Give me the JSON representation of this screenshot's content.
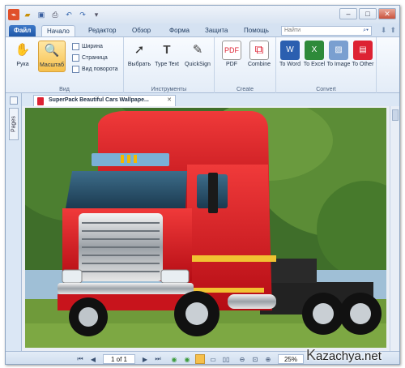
{
  "tabs": {
    "file": "Файл",
    "home": "Начало",
    "editor": "Редактор",
    "review": "Обзор",
    "form": "Форма",
    "protect": "Защита",
    "help": "Помощь"
  },
  "search": {
    "placeholder": "Найти"
  },
  "ribbon": {
    "hand": "Рука",
    "zoom": "Масштаб",
    "width": "Ширина",
    "page": "Страница",
    "rotate_view": "Вид поворота",
    "group_view": "Вид",
    "select": "Выбрать",
    "type_text": "Type Text",
    "quicksign": "QuickSign",
    "group_tools": "Инструменты",
    "pdf": "PDF",
    "combine": "Combine",
    "group_create": "Create",
    "to_word": "To Word",
    "to_excel": "To Excel",
    "to_image": "To Image",
    "to_other": "To Other",
    "group_convert": "Convert"
  },
  "document": {
    "tab_title": "SuperPack Beautiful Cars Wallpape...",
    "side_tab": "Pages"
  },
  "statusbar": {
    "page": "1 of 1",
    "zoom": "25%"
  },
  "watermark": "azachya.net",
  "colors": {
    "accent": "#1f57a8",
    "truck_red": "#d4141a",
    "highlight": "#f6c04c"
  }
}
